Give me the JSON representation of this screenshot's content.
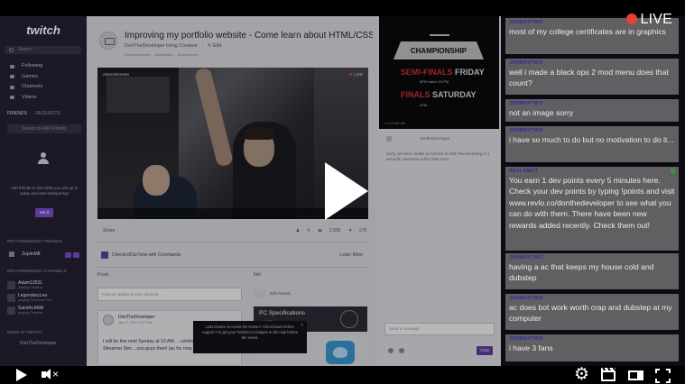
{
  "player": {
    "live_label": "LIVE"
  },
  "sidebar": {
    "logo": "twitch",
    "search_placeholder": "Search",
    "nav": [
      {
        "label": "Following"
      },
      {
        "label": "Games"
      },
      {
        "label": "Channels"
      },
      {
        "label": "Videos"
      }
    ],
    "tabs": [
      "FRIENDS",
      "REQUESTS"
    ],
    "search_friends_placeholder": "Search to Add Friends",
    "friends_message": "Add friends to see what you are up to today and start whispering!",
    "set_it_button": "Set it",
    "recommended_friends_title": "RECOMMENDED FRIENDS",
    "recommended_friend": "ZeplinM8",
    "recommended_channels_title": "RECOMMENDED CHANNELS",
    "channels": [
      {
        "name": "Adam13531",
        "sub": "playing Creative"
      },
      {
        "name": "LegendaryLea",
        "sub": "playing Pokémon Sun"
      },
      {
        "name": "SaintALAMA",
        "sub": "playing Creative"
      }
    ],
    "more_label": "MORE AT TWITCH",
    "bottom_user": "DonTheDeveloper"
  },
  "stream": {
    "title": "Improving my portfolio website - Come learn about HTML/CSS...",
    "channel": "DonTheDeveloper",
    "category": "living Creative",
    "edit_label": "Edit",
    "tags": [
      "#webdevelopment",
      "#webdesign",
      "#programming"
    ],
    "video_ad_label": "Advertisement",
    "video_live_label": "LIVE"
  },
  "subrow": {
    "share": "Share",
    "stats": [
      "4",
      "2,926",
      "179"
    ]
  },
  "chat_prompt": {
    "text": "CheckedOut  Now with Commands",
    "learn_more": "Learn More"
  },
  "panels": {
    "posts_label": "Posts",
    "info_label": "Info",
    "post_placeholder": "Post an update to your channel...",
    "edit_panels": "Edit Panels",
    "post_author": "DonTheDeveloper",
    "post_date": "Jan 17, 2017 1:47 PM",
    "post_body": "I will be live next Sunday at 10 AM ... continue on with the Streamer Sim... you guys then! (as for now, I will spend the week",
    "pc_spec_title": "PC Specifications",
    "pc_spec_sub": "... 16GB",
    "tooltip": "Last chance to revisit the lesson? Check back before August 7 to get your TwitchCon badges in the mail before the event."
  },
  "adcol": {
    "promo_title": "CHAMPIONSHIP",
    "promo_line1_red": "SEMI-FINALS",
    "promo_line1_white": "FRIDAY",
    "promo_line1_small": "5PM  twitch  10 PM",
    "promo_line2_red": "FINALS",
    "promo_line2_white": "SATURDAY",
    "promo_line2_small": "4PM",
    "promo_footer": "x  CLOSE AD",
    "user_label": "donthedeveloper",
    "description": "Sorry, we were unable to connect to chat. Reconnecting in 1 seconds. Welcome to the chat room!",
    "send_placeholder": "Send a message",
    "chat_button": "Chat"
  },
  "chat": [
    {
      "user": "JOHNNYTWO",
      "text": "most of my college certificates are in graphics"
    },
    {
      "user": "JOHNNYTWO",
      "text": "well i made a black ops 2 mod menu does that count?"
    },
    {
      "user": "JOHNNYTWO",
      "text": "not an image sorry"
    },
    {
      "user": "JOHNNYTWO",
      "text": "i have so much to do but no motivation to do it..."
    },
    {
      "user": "REVLOBOT",
      "text": "You earn 1 dev points every 5 minutes here. Check your dev points by typing !points and visit www.revlo.co/donthedeveloper to see what you can do with them. There have been new rewards added recently. Check them out!"
    },
    {
      "user": "JOHNNYTWO",
      "text": "having a ac that keeps my house cold and dubstep"
    },
    {
      "user": "JOHNNYTWO",
      "text": "ac does bot work worth crap and dubstep at my computer"
    },
    {
      "user": "JOHNNYTWO",
      "text": "i have 3 fans"
    }
  ],
  "colors": {
    "twitch_purple": "#6441a5",
    "live_red": "#e8413a",
    "chat_user": "#2c2c9c"
  },
  "icons": [
    "search-icon",
    "play-icon",
    "mute-icon",
    "gear-icon",
    "clip-icon",
    "theatre-mode-icon",
    "fullscreen-icon",
    "twitter-icon",
    "heart-icon"
  ]
}
